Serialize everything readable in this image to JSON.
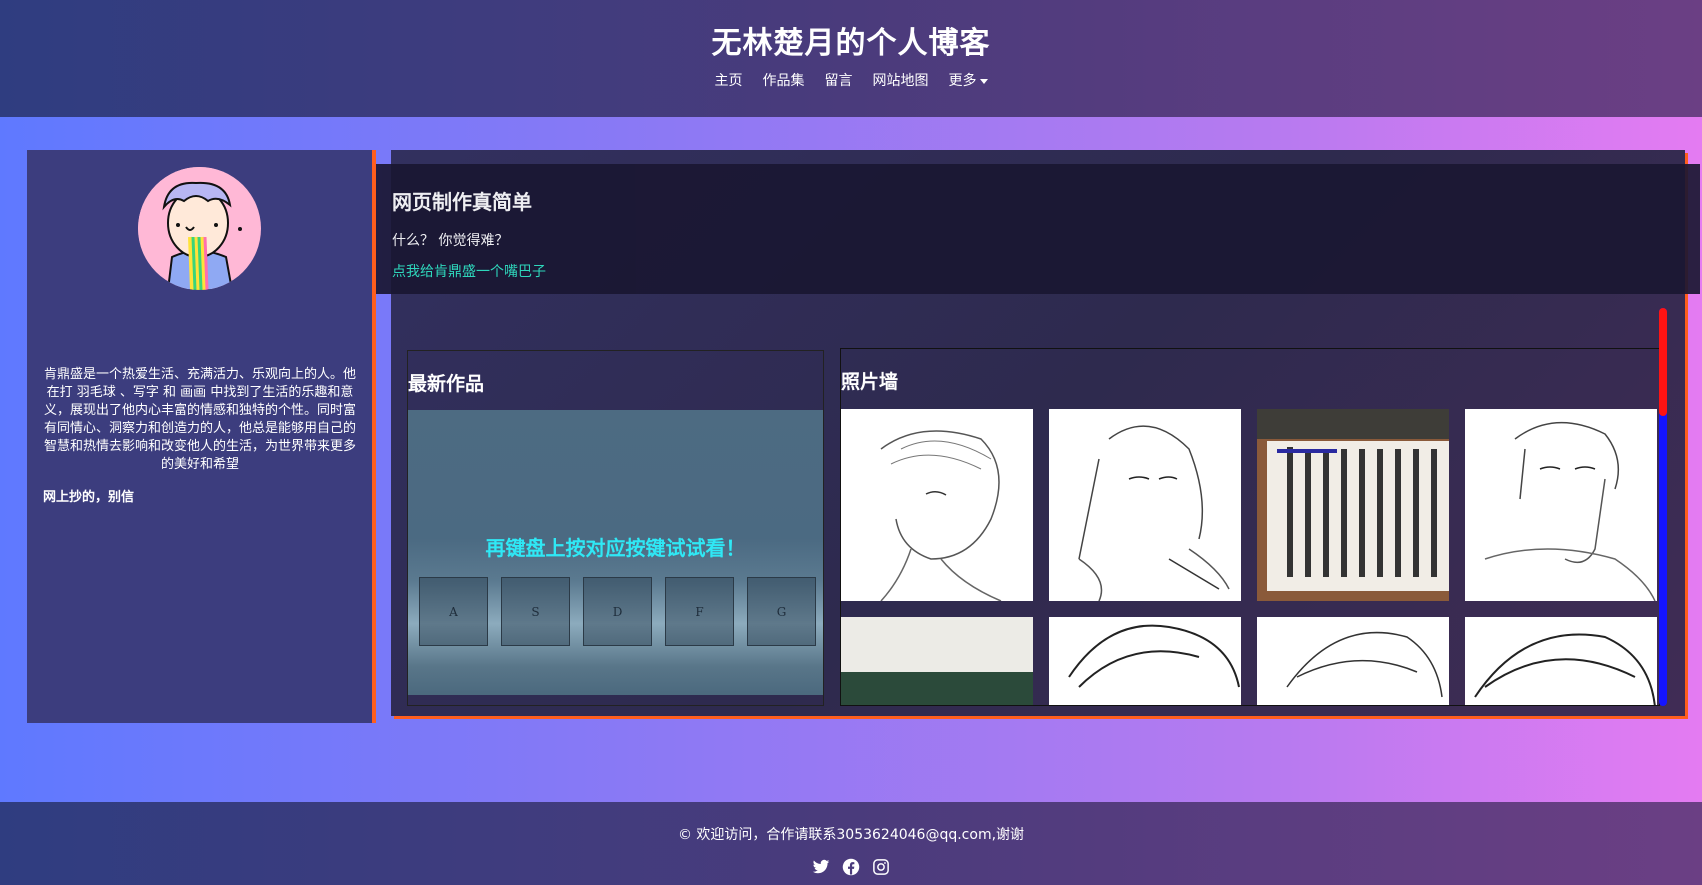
{
  "header": {
    "title": "无林楚月的个人博客",
    "nav": [
      "主页",
      "作品集",
      "留言",
      "网站地图",
      "更多"
    ]
  },
  "profile": {
    "bio": "肯鼎盛是一个热爱生活、充满活力、乐观向上的人。他在打 羽毛球 、写字 和 画画 中找到了生活的乐趣和意义，展现出了他内心丰富的情感和独特的个性。同时富有同情心、洞察力和创造力的人，他总是能够用自己的智慧和热情去影响和改变他人的生活，为世界带来更多的美好和希望",
    "note": "网上抄的，别信"
  },
  "intro": {
    "heading": "网页制作真简单",
    "question": "什么？ 你觉得难？",
    "link": "点我给肯鼎盛一个嘴巴子"
  },
  "works": {
    "heading": "最新作品",
    "message": "再键盘上按对应按键试试看！",
    "keys": [
      "A",
      "S",
      "D",
      "F",
      "G"
    ]
  },
  "photos": {
    "heading": "照片墙"
  },
  "footer": {
    "copyright": "© 欢迎访问，合作请联系3053624046@qq.com,谢谢",
    "icons": [
      "twitter-icon",
      "facebook-icon",
      "instagram-icon"
    ]
  },
  "colors": {
    "accent_orange": "#ff5e1d",
    "link_teal": "#2ee5c4",
    "key_text_cyan": "#2fe8f5"
  }
}
